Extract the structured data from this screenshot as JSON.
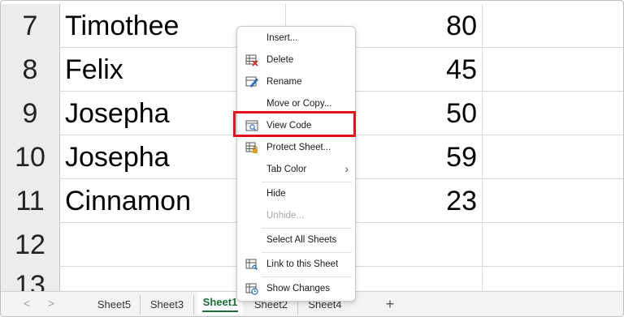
{
  "rows": [
    {
      "num": "7",
      "name": "Timothee",
      "value": "80"
    },
    {
      "num": "8",
      "name": "Felix",
      "value": "45"
    },
    {
      "num": "9",
      "name": "Josepha",
      "value": "50"
    },
    {
      "num": "10",
      "name": "Josepha",
      "value": "59"
    },
    {
      "num": "11",
      "name": "Cinnamon",
      "value": "23"
    },
    {
      "num": "12",
      "name": "",
      "value": ""
    },
    {
      "num": "13",
      "name": "",
      "value": ""
    }
  ],
  "context_menu": {
    "insert": "Insert...",
    "delete": "Delete",
    "rename": "Rename",
    "move_copy": "Move or Copy...",
    "view_code": "View Code",
    "protect_sheet": "Protect Sheet...",
    "tab_color": "Tab Color",
    "hide": "Hide",
    "unhide": "Unhide...",
    "select_all": "Select All Sheets",
    "link": "Link to this Sheet",
    "show_changes": "Show Changes"
  },
  "tabs": {
    "prev": "<",
    "next": ">",
    "sheets": [
      "Sheet5",
      "Sheet3",
      "Sheet1",
      "Sheet2",
      "Sheet4"
    ],
    "active": "Sheet1",
    "add": "+"
  },
  "colors": {
    "highlight": "#e0101a",
    "active_tab": "#1e6b36"
  }
}
